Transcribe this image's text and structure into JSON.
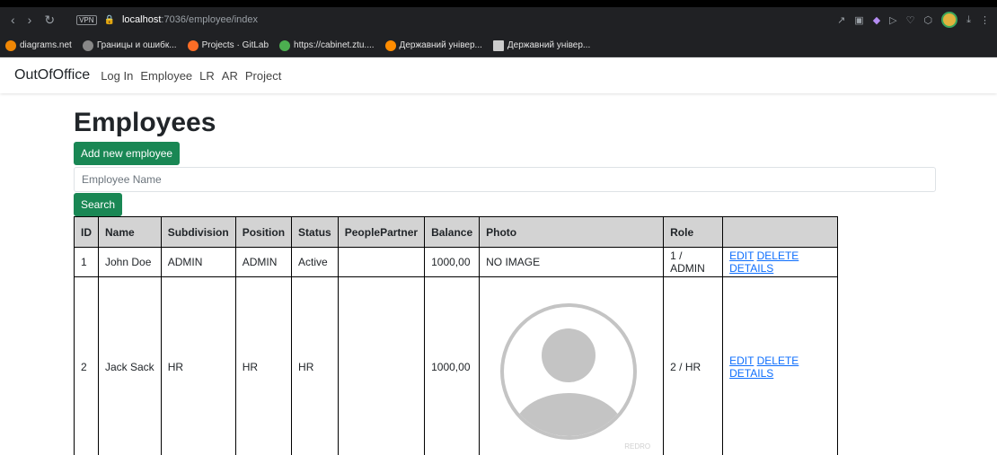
{
  "browser": {
    "url_host": "localhost",
    "url_path": ":7036/employee/index",
    "vpn": "VPN"
  },
  "bookmarks": [
    {
      "label": "diagrams.net",
      "color": "#f08705"
    },
    {
      "label": "Границы и ошибк...",
      "color": "#888888"
    },
    {
      "label": "Projects · GitLab",
      "color": "#fc6d26"
    },
    {
      "label": "https://cabinet.ztu....",
      "color": "#4caf50"
    },
    {
      "label": "Державний універ...",
      "color": "#ff8c00"
    },
    {
      "label": "Державний універ...",
      "color": "#cccccc"
    }
  ],
  "navbar": {
    "brand": "OutOfOffice",
    "links": [
      "Log In",
      "Employee",
      "LR",
      "AR",
      "Project"
    ]
  },
  "page": {
    "title": "Employees",
    "add_button": "Add new employee",
    "search_placeholder": "Employee Name",
    "search_button": "Search"
  },
  "table": {
    "headers": [
      "ID",
      "Name",
      "Subdivision",
      "Position",
      "Status",
      "PeoplePartner",
      "Balance",
      "Photo",
      "Role",
      ""
    ],
    "rows": [
      {
        "id": "1",
        "name": "John Doe",
        "subdivision": "ADMIN",
        "position": "ADMIN",
        "status": "Active",
        "partner": "",
        "balance": "1000,00",
        "photo": "NO IMAGE",
        "role": "1 / ADMIN",
        "edit": "EDIT",
        "delete": "DELETE",
        "details": "DETAILS"
      },
      {
        "id": "2",
        "name": "Jack Sack",
        "subdivision": "HR",
        "position": "HR",
        "status": "HR",
        "partner": "",
        "balance": "1000,00",
        "photo": "",
        "role": "2 / HR",
        "edit": "EDIT",
        "delete": "DELETE",
        "details": "DETAILS",
        "watermark": "REDRO"
      }
    ]
  },
  "colors": {
    "primary_green": "#198754",
    "link_blue": "#0d6efd",
    "header_gray": "#d3d3d3"
  }
}
